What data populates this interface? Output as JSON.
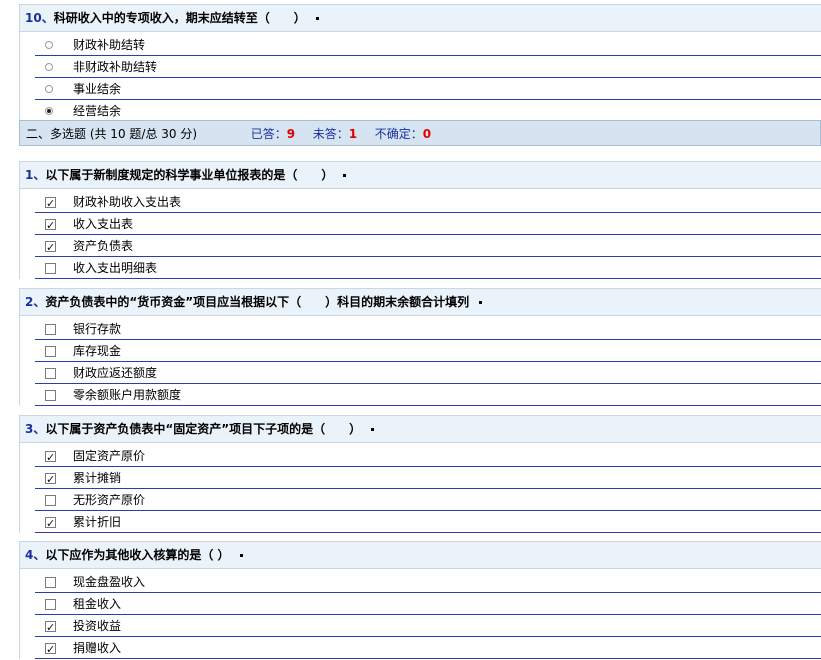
{
  "q10": {
    "number": "10",
    "sep": "、",
    "text": "科研收入中的专项收入，期末应结转至（　　）",
    "options": [
      {
        "label": "财政补助结转",
        "selected": false
      },
      {
        "label": "非财政补助结转",
        "selected": false
      },
      {
        "label": "事业结余",
        "selected": false
      },
      {
        "label": "经营结余",
        "selected": true
      }
    ]
  },
  "section": {
    "title": "二、多选题 (共 10 题/总 30 分)",
    "answered_label": "已答：",
    "answered_value": "9",
    "unanswered_label": "未答：",
    "unanswered_value": "1",
    "uncertain_label": "不确定：",
    "uncertain_value": "0"
  },
  "questions": [
    {
      "number": "1",
      "sep": "、",
      "text": "以下属于新制度规定的科学事业单位报表的是（　　）",
      "options": [
        {
          "label": "财政补助收入支出表",
          "checked": true
        },
        {
          "label": "收入支出表",
          "checked": true
        },
        {
          "label": "资产负债表",
          "checked": true
        },
        {
          "label": "收入支出明细表",
          "checked": false
        }
      ]
    },
    {
      "number": "2",
      "sep": "、",
      "text": "资产负债表中的“货币资金”项目应当根据以下（　　）科目的期末余额合计填列",
      "options": [
        {
          "label": "银行存款",
          "checked": false
        },
        {
          "label": "库存现金",
          "checked": false
        },
        {
          "label": "财政应返还额度",
          "checked": false
        },
        {
          "label": "零余额账户用款额度",
          "checked": false
        }
      ]
    },
    {
      "number": "3",
      "sep": "、",
      "text": "以下属于资产负债表中“固定资产”项目下子项的是（　　）",
      "options": [
        {
          "label": "固定资产原价",
          "checked": true
        },
        {
          "label": "累计摊销",
          "checked": true
        },
        {
          "label": "无形资产原价",
          "checked": false
        },
        {
          "label": "累计折旧",
          "checked": true
        }
      ]
    },
    {
      "number": "4",
      "sep": "、",
      "text": "以下应作为其他收入核算的是（ ）",
      "options": [
        {
          "label": "现金盘盈收入",
          "checked": false
        },
        {
          "label": "租金收入",
          "checked": false
        },
        {
          "label": "投资收益",
          "checked": true
        },
        {
          "label": "捐赠收入",
          "checked": true
        }
      ]
    }
  ]
}
